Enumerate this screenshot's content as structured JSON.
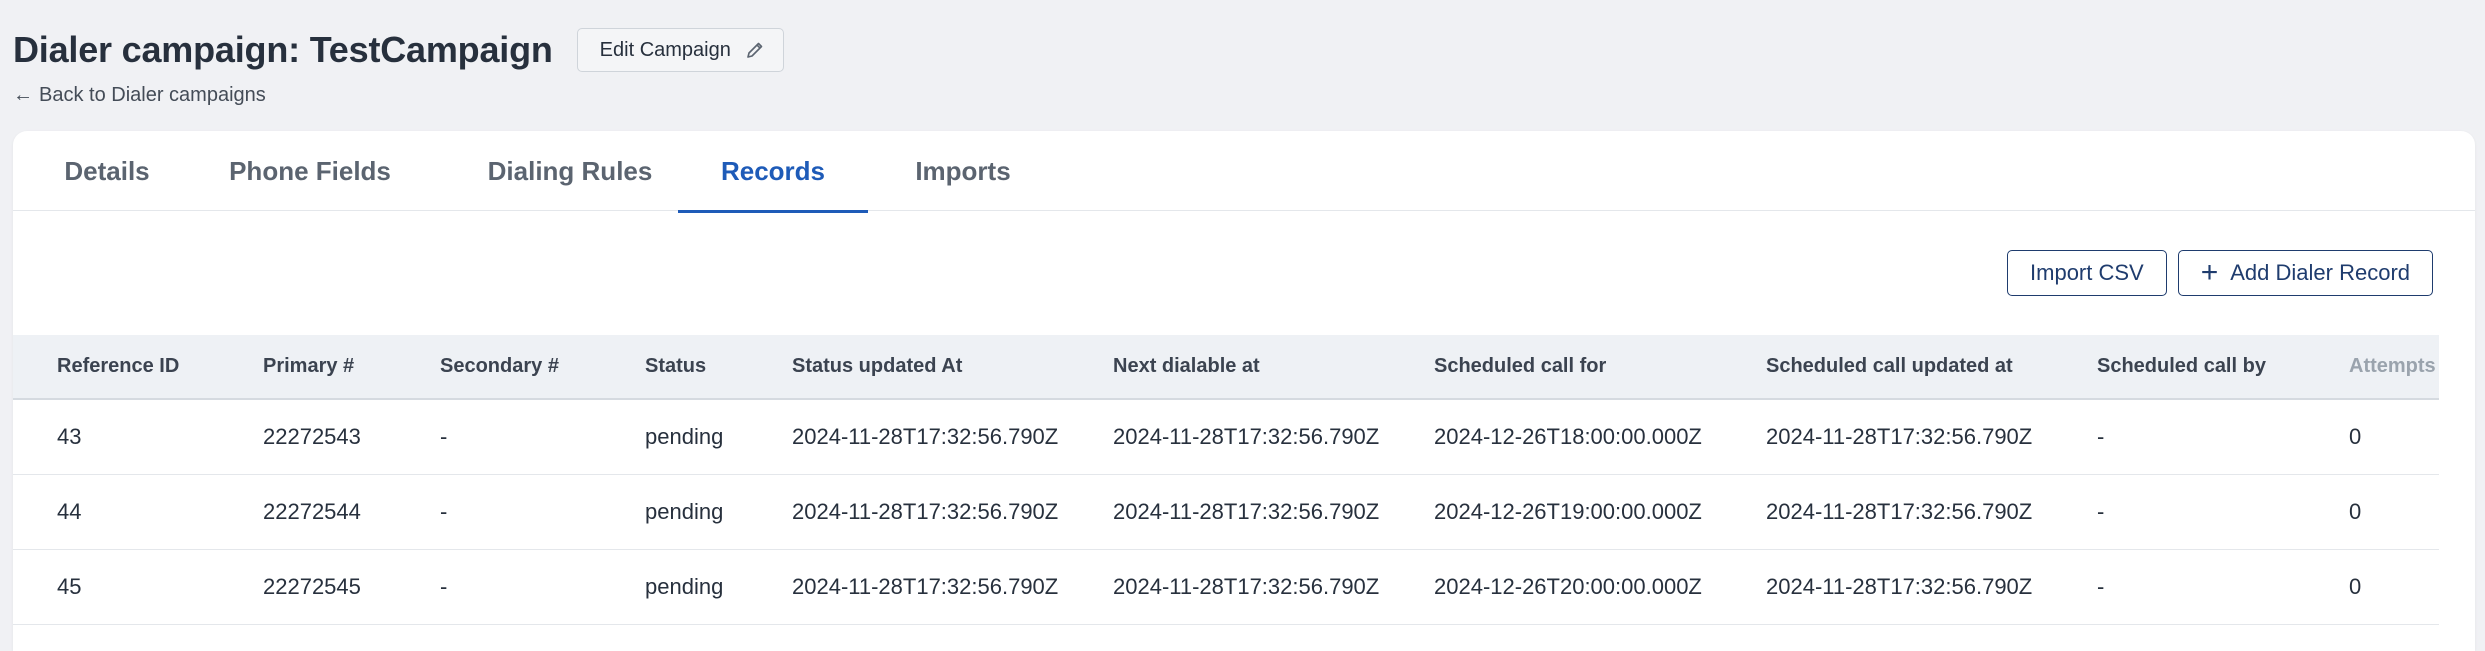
{
  "header": {
    "title": "Dialer campaign: TestCampaign",
    "edit_label": "Edit Campaign",
    "back_arrow": "←",
    "back_label": "Back to Dialer campaigns"
  },
  "tabs": [
    {
      "label": "Details",
      "active": false
    },
    {
      "label": "Phone Fields",
      "active": false
    },
    {
      "label": "Dialing Rules",
      "active": false
    },
    {
      "label": "Records",
      "active": true
    },
    {
      "label": "Imports",
      "active": false
    }
  ],
  "actions": {
    "import_label": "Import CSV",
    "add_icon": "+",
    "add_label": "Add Dialer Record"
  },
  "table": {
    "columns": [
      "Reference ID",
      "Primary #",
      "Secondary #",
      "Status",
      "Status updated At",
      "Next dialable at",
      "Scheduled call for",
      "Scheduled call updated at",
      "Scheduled call by",
      "Attempts"
    ],
    "rows": [
      [
        "43",
        "22272543",
        "-",
        "pending",
        "2024-11-28T17:32:56.790Z",
        "2024-11-28T17:32:56.790Z",
        "2024-12-26T18:00:00.000Z",
        "2024-11-28T17:32:56.790Z",
        "-",
        "0"
      ],
      [
        "44",
        "22272544",
        "-",
        "pending",
        "2024-11-28T17:32:56.790Z",
        "2024-11-28T17:32:56.790Z",
        "2024-12-26T19:00:00.000Z",
        "2024-11-28T17:32:56.790Z",
        "-",
        "0"
      ],
      [
        "45",
        "22272545",
        "-",
        "pending",
        "2024-11-28T17:32:56.790Z",
        "2024-11-28T17:32:56.790Z",
        "2024-12-26T20:00:00.000Z",
        "2024-11-28T17:32:56.790Z",
        "-",
        "0"
      ]
    ]
  },
  "colors": {
    "accent": "#1e5bb8",
    "button_border": "#1f3c6e",
    "background": "#f0f1f4"
  }
}
